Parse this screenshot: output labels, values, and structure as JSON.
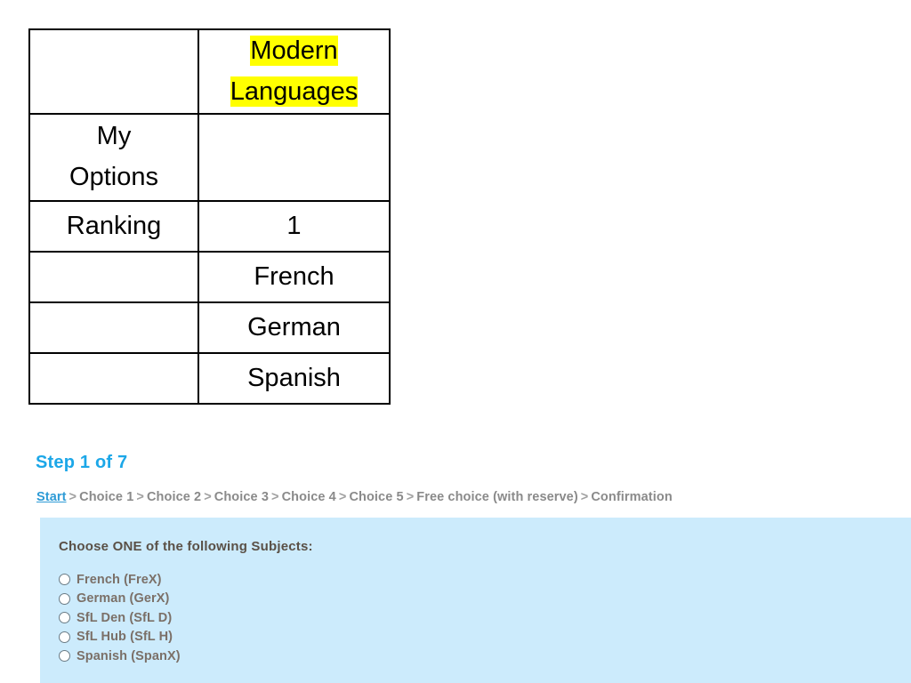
{
  "options_table": {
    "columns": [
      "",
      "Modern Languages"
    ],
    "header": {
      "label": "",
      "value": "Modern Languages",
      "value_line1": "Modern",
      "value_line2": "Languages",
      "highlight_color": "#ffff00"
    },
    "rows": [
      {
        "label": "My Options",
        "label_line1": "My",
        "label_line2": "Options",
        "value": ""
      },
      {
        "label": "Ranking",
        "value": "1"
      },
      {
        "label": "",
        "value": "French"
      },
      {
        "label": "",
        "value": "German"
      },
      {
        "label": "",
        "value": "Spanish"
      }
    ]
  },
  "wizard": {
    "step_heading": "Step 1 of 7",
    "breadcrumb": {
      "start_label": "Start",
      "separator": ">",
      "items": [
        "Choice 1",
        "Choice 2",
        "Choice 3",
        "Choice 4",
        "Choice 5",
        "Free choice (with reserve)",
        "Confirmation"
      ]
    }
  },
  "choice_panel": {
    "background_color": "#CCEBFC",
    "title": "Choose ONE of the following Subjects:",
    "options": [
      {
        "label": "French (FreX)",
        "selected": false
      },
      {
        "label": "German (GerX)",
        "selected": false
      },
      {
        "label": "SfL Den (SfL D)",
        "selected": false
      },
      {
        "label": "SfL Hub (SfL H)",
        "selected": false
      },
      {
        "label": "Spanish (SpanX)",
        "selected": false
      }
    ]
  },
  "colors": {
    "step_heading": "#1CA7E8",
    "breadcrumb_link": "#2E9BD6",
    "breadcrumb_text": "#8a8a8a",
    "panel_bg": "#CCEBFC",
    "panel_text": "#7b7068",
    "highlight": "#ffff00",
    "table_border": "#000000"
  }
}
